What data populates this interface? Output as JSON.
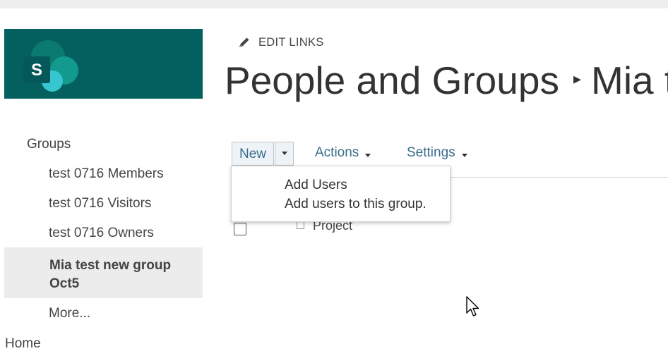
{
  "header": {
    "edit_links": "EDIT LINKS",
    "title_part1": "People and Groups",
    "title_separator": "▸",
    "title_part2": "Mia te"
  },
  "logo": {
    "letter": "S",
    "brand_color": "#03605e"
  },
  "quick_launch": {
    "heading": "Groups",
    "items": [
      {
        "label": "test 0716 Members"
      },
      {
        "label": "test 0716 Visitors"
      },
      {
        "label": "test 0716 Owners"
      }
    ],
    "selected": "Mia test new group Oct5",
    "more": "More...",
    "home": "Home"
  },
  "toolbar": {
    "new_label": "New",
    "actions_label": "Actions",
    "settings_label": "Settings"
  },
  "dropdown": {
    "title": "Add Users",
    "description": "Add users to this group."
  },
  "list": {
    "column_label": "Project"
  },
  "colors": {
    "accent": "#3a6e8c",
    "text": "#444444",
    "selected_bg": "#ececec"
  },
  "icons": {
    "edit": "pencil-icon",
    "logo": "sharepoint-logo-icon",
    "cursor": "mouse-cursor-icon"
  }
}
